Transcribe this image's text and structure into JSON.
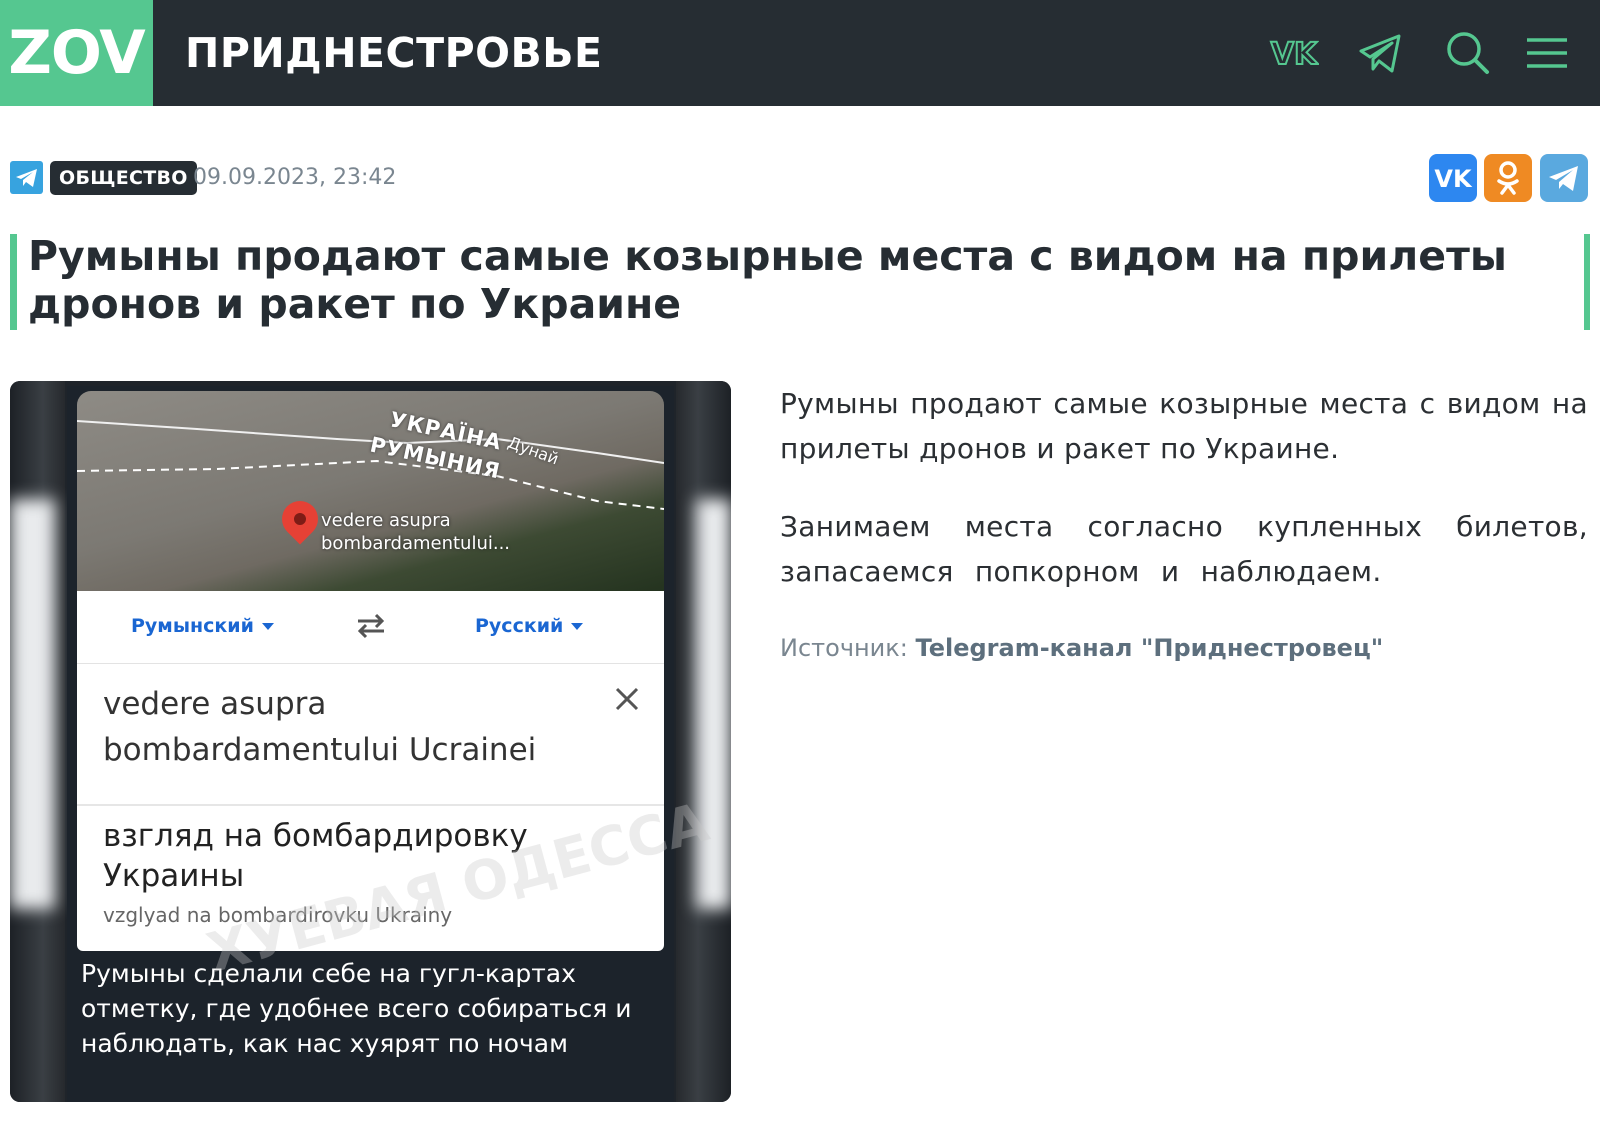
{
  "header": {
    "logo": "ZOV",
    "title": "ПРИДНЕСТРОВЬЕ",
    "icons": [
      "vk-icon",
      "telegram-icon",
      "search-icon",
      "menu-icon"
    ],
    "background": "#262d33",
    "accent": "#55c790"
  },
  "article": {
    "category": "ОБЩЕСТВО",
    "date": "09.09.2023, 23:42",
    "title": "Румыны продают самые козырные места с видом на прилеты дронов и ракет по Украине",
    "share": [
      "vk-icon",
      "odnoklassniki-icon",
      "telegram-icon"
    ],
    "paragraphs": [
      "Румыны продают самые козырные места с видом на прилеты дронов и ракет по Украине.",
      "Занимаем места согласно купленных билетов, запасаемся попкорном и наблюдаем."
    ],
    "source_label": "Источник:",
    "source_link": "Telegram-канал \"Приднестровец\""
  },
  "photo": {
    "map_label_ua": "УКРАЇНА",
    "map_label_ro": "РУМЫНИЯ",
    "map_label_river": "Дунай",
    "pin_label_1": "vedere asupra",
    "pin_label_2": "bombardamentului...",
    "lang_from": "Румынский",
    "lang_to": "Русский",
    "source_text": "vedere asupra bombardamentului Ucrainei",
    "translation": "взгляд на бомбардировку Украины",
    "transliteration": "vzglyad na bombardirovku Ukrainy",
    "caption": "Румыны сделали себе на гугл-картах отметку, где удобнее всего собираться и наблюдать, как нас хуярят по ночам",
    "watermark": "ХУЕВАЯ ОДЕССА"
  }
}
